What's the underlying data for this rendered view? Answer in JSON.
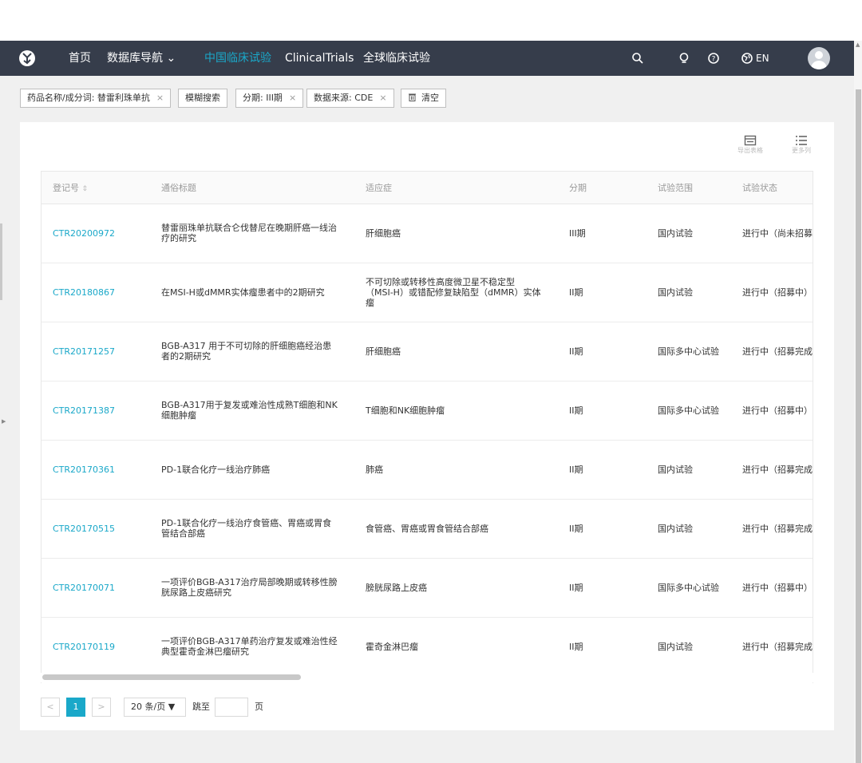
{
  "nav": {
    "items": [
      {
        "label": "首页"
      },
      {
        "label": "数据库导航 ⌄"
      },
      {
        "label": "中国临床试验"
      },
      {
        "label": "ClinicalTrials"
      },
      {
        "label": "全球临床试验"
      }
    ],
    "search_icon": "⚲",
    "bulb_icon": "♁",
    "help_icon": "?",
    "lang_label": "EN"
  },
  "filters": [
    {
      "label": "药品名称/成分词: 替雷利珠单抗",
      "remove": "×"
    },
    {
      "label": "模糊搜索",
      "remove": ""
    },
    {
      "label": "分期: III期",
      "remove": "×"
    },
    {
      "label": "数据来源: CDE",
      "remove": "×"
    },
    {
      "label": "清空",
      "icon": "trash-icon"
    }
  ],
  "toolbar": {
    "export_label": "导出表格",
    "more_cols_label": "更多列"
  },
  "table": {
    "headers": [
      "登记号",
      "通俗标题",
      "适应症",
      "分期",
      "试验范围",
      "试验状态"
    ],
    "rows": [
      {
        "id": "CTR20200972",
        "title": "替雷丽珠单抗联合仑伐替尼在晚期肝癌一线治疗的研究",
        "indication": "肝细胞癌",
        "phase": "III期",
        "scope": "国内试验",
        "status": "进行中（尚未招募）"
      },
      {
        "id": "CTR20180867",
        "title": "在MSI-H或dMMR实体瘤患者中的2期研究",
        "indication": "不可切除或转移性高度微卫星不稳定型（MSI-H）或错配修复缺陷型（dMMR）实体瘤",
        "phase": "II期",
        "scope": "国内试验",
        "status": "进行中（招募中）"
      },
      {
        "id": "CTR20171257",
        "title": "BGB-A317 用于不可切除的肝细胞癌经治患者的2期研究",
        "indication": "肝细胞癌",
        "phase": "II期",
        "scope": "国际多中心试验",
        "status": "进行中（招募完成）"
      },
      {
        "id": "CTR20171387",
        "title": "BGB-A317用于复发或难治性成熟T细胞和NK细胞肿瘤",
        "indication": "T细胞和NK细胞肿瘤",
        "phase": "II期",
        "scope": "国际多中心试验",
        "status": "进行中（招募中）"
      },
      {
        "id": "CTR20170361",
        "title": "PD-1联合化疗一线治疗肺癌",
        "indication": "肺癌",
        "phase": "II期",
        "scope": "国内试验",
        "status": "进行中（招募完成）"
      },
      {
        "id": "CTR20170515",
        "title": "PD-1联合化疗一线治疗食管癌、胃癌或胃食管结合部癌",
        "indication": "食管癌、胃癌或胃食管结合部癌",
        "phase": "II期",
        "scope": "国内试验",
        "status": "进行中（招募完成）"
      },
      {
        "id": "CTR20170071",
        "title": "一项评价BGB-A317治疗局部晚期或转移性膀胱尿路上皮癌研究",
        "indication": "膀胱尿路上皮癌",
        "phase": "II期",
        "scope": "国际多中心试验",
        "status": "进行中（招募中）"
      },
      {
        "id": "CTR20170119",
        "title": "一项评价BGB-A317单药治疗复发或难治性经典型霍奇金淋巴瘤研究",
        "indication": "霍奇金淋巴瘤",
        "phase": "II期",
        "scope": "国内试验",
        "status": "进行中（招募完成）"
      }
    ]
  },
  "pagination": {
    "prev": "<",
    "current": "1",
    "next": ">",
    "page_size": "20 条/页 ▼",
    "jump_label": "跳至",
    "page_unit": "页"
  }
}
